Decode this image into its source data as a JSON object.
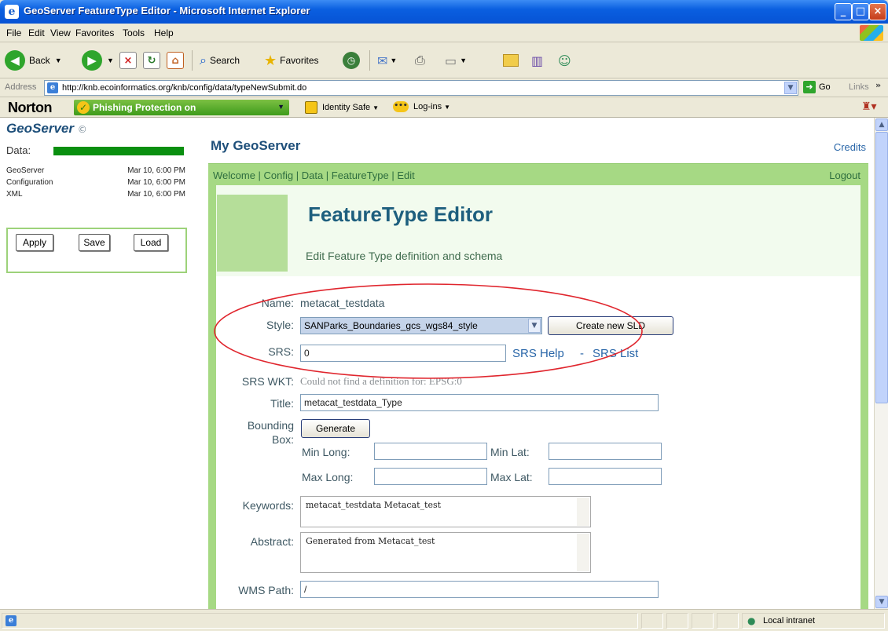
{
  "window": {
    "title": "GeoServer FeatureType Editor - Microsoft Internet Explorer"
  },
  "menu": [
    "File",
    "Edit",
    "View",
    "Favorites",
    "Tools",
    "Help"
  ],
  "toolbar": {
    "back": "Back",
    "search": "Search",
    "favorites": "Favorites"
  },
  "address": {
    "label": "Address",
    "url": "http://knb.ecoinformatics.org/knb/config/data/typeNewSubmit.do",
    "go": "Go",
    "links": "Links"
  },
  "norton": {
    "logo": "Norton",
    "phishing": "Phishing Protection on",
    "identity": "Identity Safe",
    "logins": "Log-ins"
  },
  "sidebar": {
    "title": "GeoServer",
    "data_label": "Data:",
    "rows": [
      {
        "name": "GeoServer",
        "date": "Mar 10, 6:00 PM"
      },
      {
        "name": "Configuration",
        "date": "Mar 10, 6:00 PM"
      },
      {
        "name": "XML",
        "date": "Mar 10, 6:00 PM"
      }
    ],
    "buttons": {
      "apply": "Apply",
      "save": "Save",
      "load": "Load"
    }
  },
  "page": {
    "title": "My GeoServer",
    "credits": "Credits",
    "breadcrumb": "Welcome | Config | Data | FeatureType | Edit",
    "logout": "Logout",
    "heading": "FeatureType Editor",
    "subheading": "Edit Feature Type definition and schema"
  },
  "form": {
    "name_label": "Name:",
    "name_value": "metacat_testdata",
    "style_label": "Style:",
    "style_value": "SANParks_Boundaries_gcs_wgs84_style",
    "create_sld": "Create new SLD",
    "srs_label": "SRS:",
    "srs_value": "0",
    "srs_help": "SRS Help",
    "srs_dash": "-",
    "srs_list": "SRS List",
    "srs_wkt_label": "SRS WKT:",
    "srs_wkt_value": "Could not find a definition for: EPSG:0",
    "title_label": "Title:",
    "title_value": "metacat_testdata_Type",
    "bbox_label_1": "Bounding",
    "bbox_label_2": "Box:",
    "generate": "Generate",
    "min_long": "Min Long:",
    "min_lat": "Min Lat:",
    "max_long": "Max Long:",
    "max_lat": "Max Lat:",
    "keywords_label": "Keywords:",
    "keywords_value": "metacat_testdata Metacat_test",
    "abstract_label": "Abstract:",
    "abstract_value": "Generated from Metacat_test",
    "wms_label": "WMS Path:",
    "wms_value": "/"
  },
  "status": {
    "zone": "Local intranet"
  },
  "colors": {
    "accent_green": "#A6D984",
    "link_blue": "#2966A8",
    "title_blue": "#1E4F7A",
    "annotation_red": "#E0262E"
  }
}
